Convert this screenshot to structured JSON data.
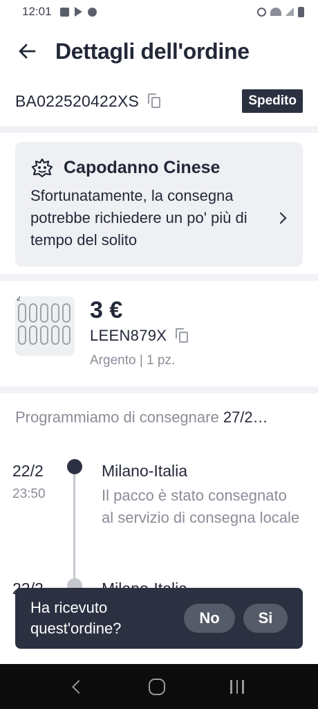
{
  "status_bar": {
    "time": "12:01",
    "left_icons": [
      "gallery-icon",
      "play-store-icon",
      "messenger-icon"
    ],
    "right_icons": [
      "alarm-icon",
      "wifi-icon",
      "signal-icon",
      "battery-icon"
    ]
  },
  "header": {
    "title": "Dettagli dell'ordine",
    "back_icon": "arrow-left-icon"
  },
  "order": {
    "id": "BA022520422XS",
    "status": "Spedito"
  },
  "notice": {
    "icon": "lion-dance-icon",
    "title": "Capodanno Cinese",
    "text": "Sfortunatamente, la consegna potrebbe richiedere un po' più di tempo del solito"
  },
  "product": {
    "qty_mark": "2",
    "price": "3 €",
    "sku": "LEEN879X",
    "variant": "Argento | 1 pz."
  },
  "delivery": {
    "label": "Programmiamo di consegnare",
    "date": "27/2…"
  },
  "timeline": [
    {
      "date": "22/2",
      "time": "23:50",
      "location": "Milano-Italia",
      "description": "Il pacco è stato consegnato al servizio di consegna locale"
    },
    {
      "date": "22/2",
      "location": "Milano-Italia"
    }
  ],
  "prompt": {
    "question": "Ha ricevuto quest'ordine?",
    "no_label": "No",
    "yes_label": "Si"
  },
  "colors": {
    "primary": "#2c3142",
    "text": "#232838",
    "muted": "#8a8d98",
    "card_bg": "#eff0f4"
  }
}
